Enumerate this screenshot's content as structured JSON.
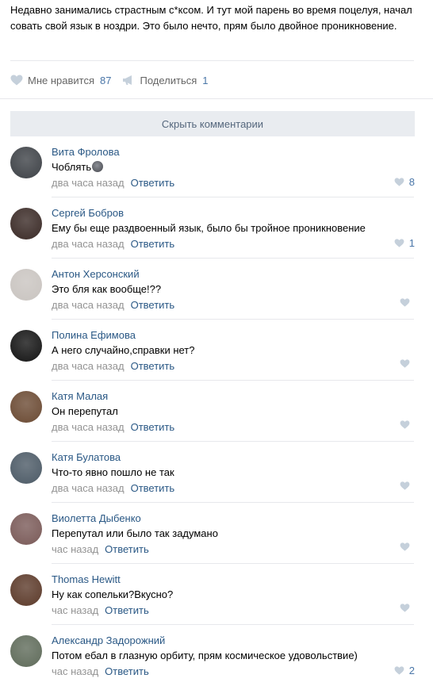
{
  "post": {
    "text": "Недавно занимались страстным с*ксом. И тут мой парень во время поцелуя, начал совать свой язык в ноздри. Это было нечто, прям было двойное проникновение.",
    "like_label": "Мне нравится",
    "like_count": "87",
    "share_label": "Поделиться",
    "share_count": "1"
  },
  "hide_comments_label": "Скрыть комментарии",
  "comments": [
    {
      "author": "Вита Фролова",
      "text": "Чоблять",
      "time": "два часа назад",
      "reply": "Ответить",
      "likes": "8",
      "avatar_color": "#3e4247"
    },
    {
      "author": "Сергей Бобров",
      "text": "Ему бы еще раздвоенный язык, было бы тройное проникновение",
      "time": "два часа назад",
      "reply": "Ответить",
      "likes": "1",
      "avatar_color": "#3a2a26"
    },
    {
      "author": "Антон Херсонский",
      "text": "Это бля как вообще!??",
      "time": "два часа назад",
      "reply": "Ответить",
      "likes": "",
      "avatar_color": "#c9c4c0"
    },
    {
      "author": "Полина Ефимова",
      "text": "А него случайно,справки нет?",
      "time": "два часа назад",
      "reply": "Ответить",
      "likes": "",
      "avatar_color": "#141414"
    },
    {
      "author": "Катя Малая",
      "text": "Он перепутал",
      "time": "два часа назад",
      "reply": "Ответить",
      "likes": "",
      "avatar_color": "#6b4a33"
    },
    {
      "author": "Катя Булатова",
      "text": "Что-то явно пошло не так",
      "time": "два часа назад",
      "reply": "Ответить",
      "likes": "",
      "avatar_color": "#4c5a66"
    },
    {
      "author": "Виолетта Дыбенко",
      "text": "Перепутал или было так задумано",
      "time": "час назад",
      "reply": "Ответить",
      "likes": "",
      "avatar_color": "#7a5a58"
    },
    {
      "author": "Thomas Hewitt",
      "text": "Ну как сопельки?Вкусно?",
      "time": "час назад",
      "reply": "Ответить",
      "likes": "",
      "avatar_color": "#5c3a2a"
    },
    {
      "author": "Александр Задорожний",
      "text": "Потом ебал в глазную орбиту, прям космическое удовольствие)",
      "time": "час назад",
      "reply": "Ответить",
      "likes": "2",
      "avatar_color": "#5f6b5a"
    }
  ],
  "colors": {
    "link": "#2a5885",
    "meta": "#939393",
    "like_icon": "#c5d0db",
    "bar_bg": "#e9ecf0"
  }
}
